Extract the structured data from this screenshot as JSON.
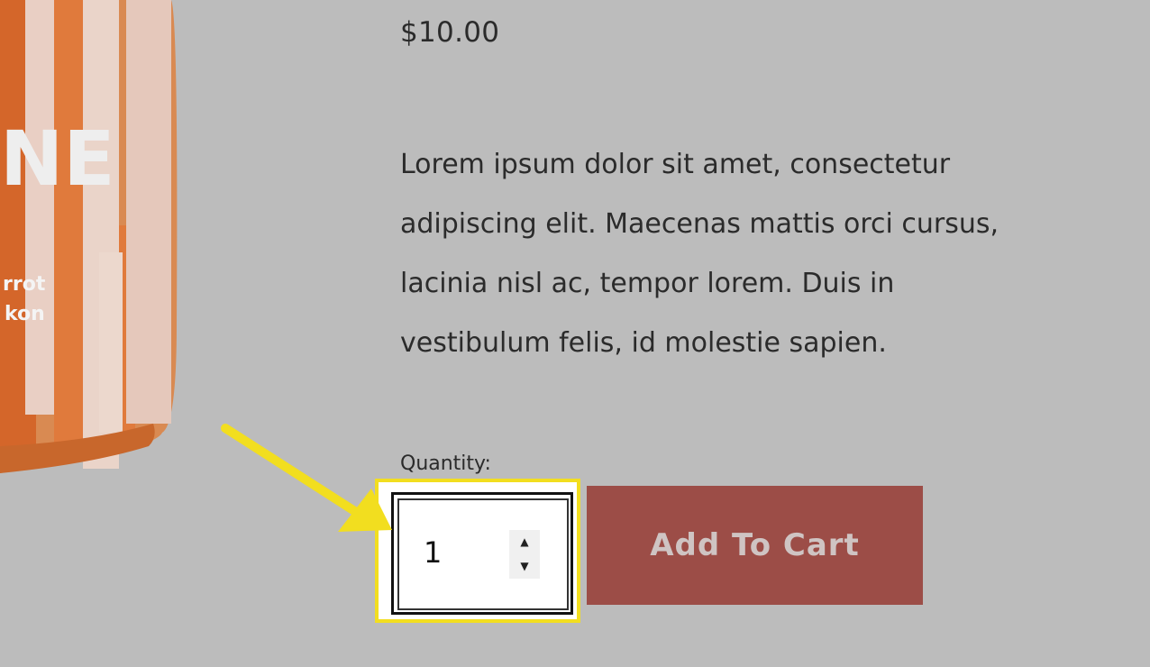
{
  "product": {
    "price": "$10.00",
    "description_lines": [
      "Lorem ipsum dolor sit amet, consectetur",
      "adipiscing elit. Maecenas mattis orci cursus,",
      "lacinia nisl ac, tempor lorem. Duis in",
      "vestibulum felis, id molestie sapien."
    ],
    "image_label": {
      "big": "NE",
      "line1": "rrot",
      "line2": "kon"
    }
  },
  "quantity": {
    "label": "Quantity:",
    "value": "1",
    "up_icon": "triangle-up",
    "down_icon": "triangle-down"
  },
  "cart": {
    "button_label": "Add To Cart"
  },
  "colors": {
    "background": "#bcbcbc",
    "button": "#9c4d47",
    "highlight": "#f2de1f",
    "arrow": "#f2de1f"
  }
}
